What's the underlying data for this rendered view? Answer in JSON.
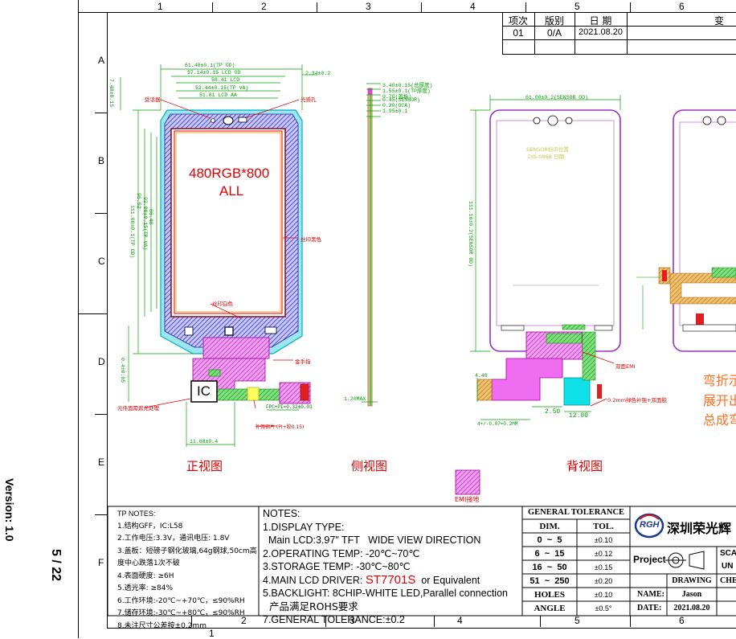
{
  "side_vertical": {
    "version": "Version: 1.0",
    "page": "5 / 22"
  },
  "zones": {
    "cols_top": [
      "1",
      "2",
      "3",
      "4",
      "5",
      "6"
    ],
    "cols_bottom": [
      "1",
      "2",
      "3",
      "4",
      "5",
      "6"
    ],
    "rows": [
      "A",
      "B",
      "C",
      "D",
      "E",
      "F"
    ]
  },
  "revision_table": {
    "headers": [
      "项次",
      "版别",
      "日 期",
      "变"
    ],
    "row": [
      "01",
      "0/A",
      "2021.08.20"
    ]
  },
  "front_view": {
    "title": "正视图",
    "resolution": "480RGB*800",
    "resolution2": "ALL",
    "ic_label": "IC",
    "dims": {
      "tp_od_w": "61.40±0.1(TP OD)",
      "lcd_od_w": "57.14±0.15  LCD  OD",
      "lcd_aa_w": "58.41  LCD",
      "tp_va_w": "52.44±0.15(TP VA)",
      "lcd_aa2_w": "51.81  LCD  AA",
      "left_off": "7.48±0.15",
      "right_off": "2.34±0.2",
      "tp_od_h": "111.60±0.1(TP OD)",
      "tp_va_h": "92.00±0.15(TP VA)",
      "lcd_h1": "96.52",
      "lcd_h2": "86.40",
      "fpc_w": "11.68±0.4",
      "fpc_pin": "FPC+PI=0.32±0.03",
      "pitch": "0.4±0.05"
    },
    "labels": {
      "top_left": "受话器",
      "top_right": "光感孔",
      "side_right": "丝印黑色",
      "bottom_red": "丝印白色",
      "fpc_right": "金手指",
      "bottom_left": "元件面需遮光处理",
      "bottom_mid": "补强钢片 (PI+胶0.15)"
    }
  },
  "side_view": {
    "title": "侧视图",
    "dims": {
      "total": "3.40±0.15(总厚度)",
      "tp": "1.55±0.1(TP厚度)",
      "oca": "0.70(盖板)",
      "sensor": "0.45(SENSOR)",
      "gap": "0.20(OCA)",
      "lcd": "1.95±0.1",
      "bottom": "1.20MAX"
    }
  },
  "back_view": {
    "title": "背视图",
    "dims": {
      "sensor_w": "61.00±0.2(SENSOR OD)",
      "sensor_h": "111.16±0.2(SENSOR OD)",
      "fpc_left": "4.40",
      "fpc_gap": "2.50",
      "fpc_w": "12.00",
      "bottom": "4+/-0.07=0.2MM"
    },
    "labels": {
      "inner1": "SENSOR标识位置",
      "inner2": "DIS-0868  日期",
      "emi": "双面EMI",
      "tape": "0.2mm绿色补强+双面胶"
    }
  },
  "bend_note": [
    "弯折示",
    "展开出",
    "总成弯"
  ],
  "emi_legend": "EMI接地",
  "tp_notes": {
    "title": "TP NOTES:",
    "items": [
      "1.结构GFF，IC:L58",
      "2.工作电压:3.3V，通讯电压: 1.8V",
      "3.盖板：短磅子钢化玻璃,64g钢球,50cm高",
      "度中心跌落1次不破",
      "4.表面硬度: ≥6H",
      "5.透光率: ≥84%",
      "6.工作环境:-20℃~+70℃，≤90%RH",
      "7.储存环境:-30℃~+80℃，≤90%RH",
      "8.未注尺寸公差按±0.2mm"
    ]
  },
  "notes": {
    "title": "NOTES:",
    "items": [
      {
        "text": "1.DISPLAY TYPE:"
      },
      {
        "text": "  Main LCD:3.97\" TFT   WIDE VIEW DIRECTION"
      },
      {
        "text": "2.OPERATING TEMP: -20℃~70℃"
      },
      {
        "text": "3.STORAGE TEMP: -30℃~80℃"
      },
      {
        "text": "4.MAIN LCD DRIVER: ",
        "red": "ST7701S",
        "tail": "  or Equivalent"
      },
      {
        "text": "5.BACKLIGHT: 8CHIP-WHITE LED,Parallel connection"
      },
      {
        "text": "  产品满足ROHS要求"
      },
      {
        "text": "7.GENERAL TOLERANCE:±0.2"
      }
    ]
  },
  "tolerance": {
    "title": "GENERAL TOLERANCE",
    "headers": [
      "DIM.",
      "TOL."
    ],
    "rows": [
      [
        "0  ~  5",
        "±0.10"
      ],
      [
        "6  ~  15",
        "±0.12"
      ],
      [
        "16  ~  50",
        "±0.15"
      ],
      [
        "51  ~  250",
        "±0.20"
      ],
      [
        "HOLES",
        "±0.10"
      ],
      [
        "ANGLE",
        "±0.5°"
      ]
    ]
  },
  "title_block": {
    "logo": "RGH",
    "company": "深圳荣光辉",
    "project": "Project",
    "sca": "SCA",
    "unit": "UN",
    "drawing": "DRAWING",
    "check": "CHE",
    "name_label": "NAME:",
    "name": "Jason",
    "date_label": "DATE:",
    "date": "2021.08.20"
  },
  "colors": {
    "green": "#00a000",
    "purple": "#9b30c8",
    "cyan": "#00c8d0",
    "magenta": "#e040e0",
    "blue_hatch": "#3838d8",
    "red": "#e00000"
  }
}
